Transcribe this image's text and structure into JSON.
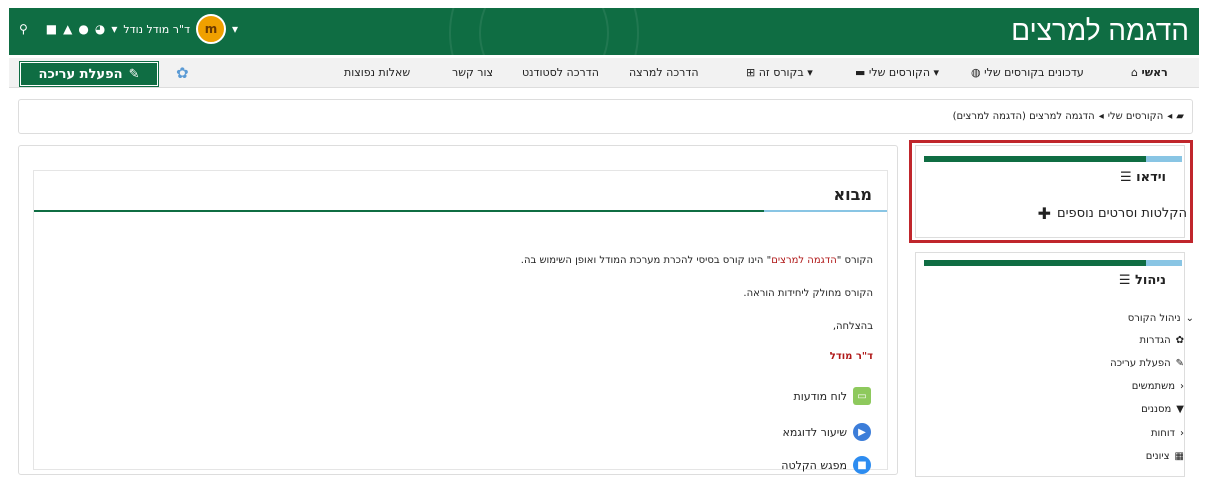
{
  "header": {
    "site_name": "הדגמה למרצים",
    "user_name": "ד\"ר מודל נודל"
  },
  "nav": {
    "home": "ראשי",
    "course_updates": "עדכונים בקורסים שלי",
    "my_courses": "הקורסים שלי",
    "this_course": "בקורס זה",
    "lecturer_guide": "הדרכה למרצה",
    "student_guide": "הדרכה לסטודנט",
    "contact": "צור קשר",
    "faq": "שאלות נפוצות",
    "edit_mode": "הפעלת עריכה"
  },
  "breadcrumb": {
    "my_courses": "הקורסים שלי",
    "course": "הדגמה למרצים (הדגמה למרצים)"
  },
  "main": {
    "section_title": "מבוא",
    "line1_prefix": "הקורס \"",
    "line1_course": "הדגמה למרצים",
    "line1_suffix": "\" הינו קורס בסיסי להכרת מערכת המודל ואופן השימוש בה.",
    "line2": "הקורס מחולק ליחידות הוראה.",
    "line3": "בהצלחה,",
    "signature": "ד\"ר מודל",
    "activities": [
      {
        "label": "לוח מודעות",
        "icon": "forum-icon"
      },
      {
        "label": "שיעור לדוגמא",
        "icon": "video-play-icon"
      },
      {
        "label": "מפגש הקלטה",
        "icon": "camera-icon"
      }
    ]
  },
  "video_block": {
    "title": "וידאו",
    "more_link": "הקלטות וסרטים נוספים"
  },
  "admin_block": {
    "title": "ניהול",
    "items": [
      {
        "label": "ניהול הקורס",
        "icon": "chevron-down-icon"
      },
      {
        "label": "הגדרות",
        "icon": "gear-icon"
      },
      {
        "label": "הפעלת עריכה",
        "icon": "pencil-icon"
      },
      {
        "label": "משתמשים",
        "icon": "chevron-right-icon"
      },
      {
        "label": "מסננים",
        "icon": "filter-icon"
      },
      {
        "label": "דוחות",
        "icon": "chevron-right-icon"
      },
      {
        "label": "ציונים",
        "icon": "table-icon"
      }
    ]
  },
  "colors": {
    "brand_green": "#0f6d43",
    "accent_light_blue": "#89c5e4",
    "highlight_red": "#c0262c"
  }
}
